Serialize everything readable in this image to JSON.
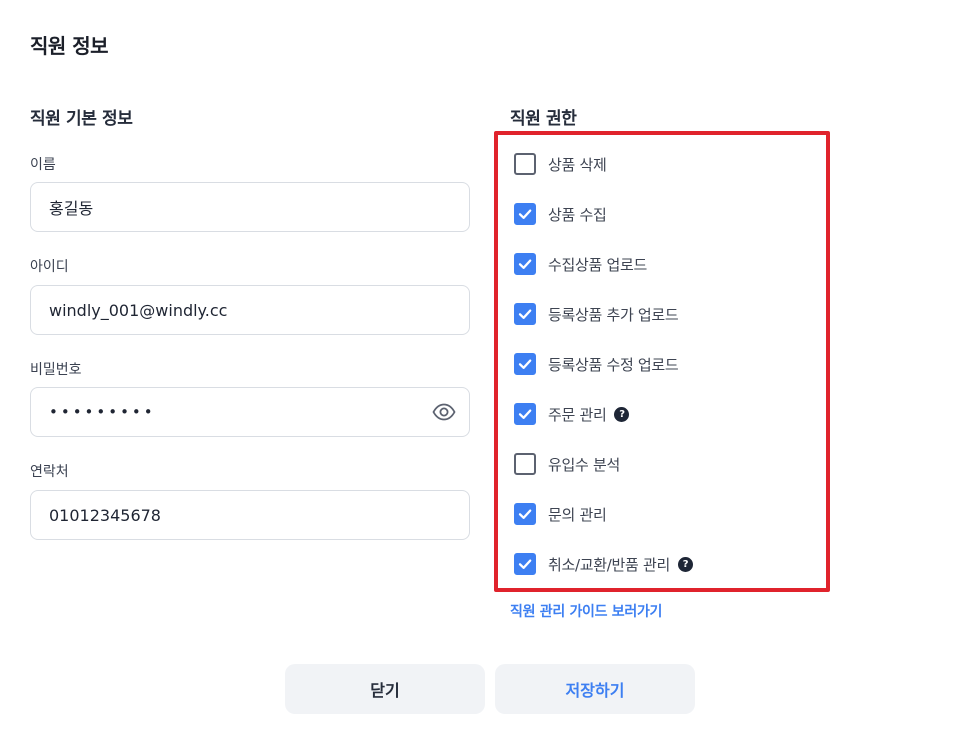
{
  "page_title": "직원 정보",
  "basic_info": {
    "title": "직원 기본 정보",
    "fields": {
      "name": {
        "label": "이름",
        "value": "홍길동"
      },
      "id": {
        "label": "아이디",
        "value": "windly_001@windly.cc"
      },
      "password": {
        "label": "비밀번호",
        "value": "•••••••••",
        "icon": "eye-icon"
      },
      "contact": {
        "label": "연락처",
        "value": "01012345678"
      }
    }
  },
  "permissions": {
    "title": "직원 권한",
    "highlight_color": "#e0232c",
    "check_color": "#3d7ff2",
    "items": [
      {
        "label": "상품 삭제",
        "checked": false,
        "help": false
      },
      {
        "label": "상품 수집",
        "checked": true,
        "help": false
      },
      {
        "label": "수집상품 업로드",
        "checked": true,
        "help": false
      },
      {
        "label": "등록상품 추가 업로드",
        "checked": true,
        "help": false
      },
      {
        "label": "등록상품 수정 업로드",
        "checked": true,
        "help": false
      },
      {
        "label": "주문 관리",
        "checked": true,
        "help": true
      },
      {
        "label": "유입수 분석",
        "checked": false,
        "help": false
      },
      {
        "label": "문의 관리",
        "checked": true,
        "help": false
      },
      {
        "label": "취소/교환/반품 관리",
        "checked": true,
        "help": true
      }
    ],
    "help_glyph": "?",
    "guide_link": "직원 관리 가이드 보러가기"
  },
  "buttons": {
    "close_label": "닫기",
    "save_label": "저장하기"
  }
}
